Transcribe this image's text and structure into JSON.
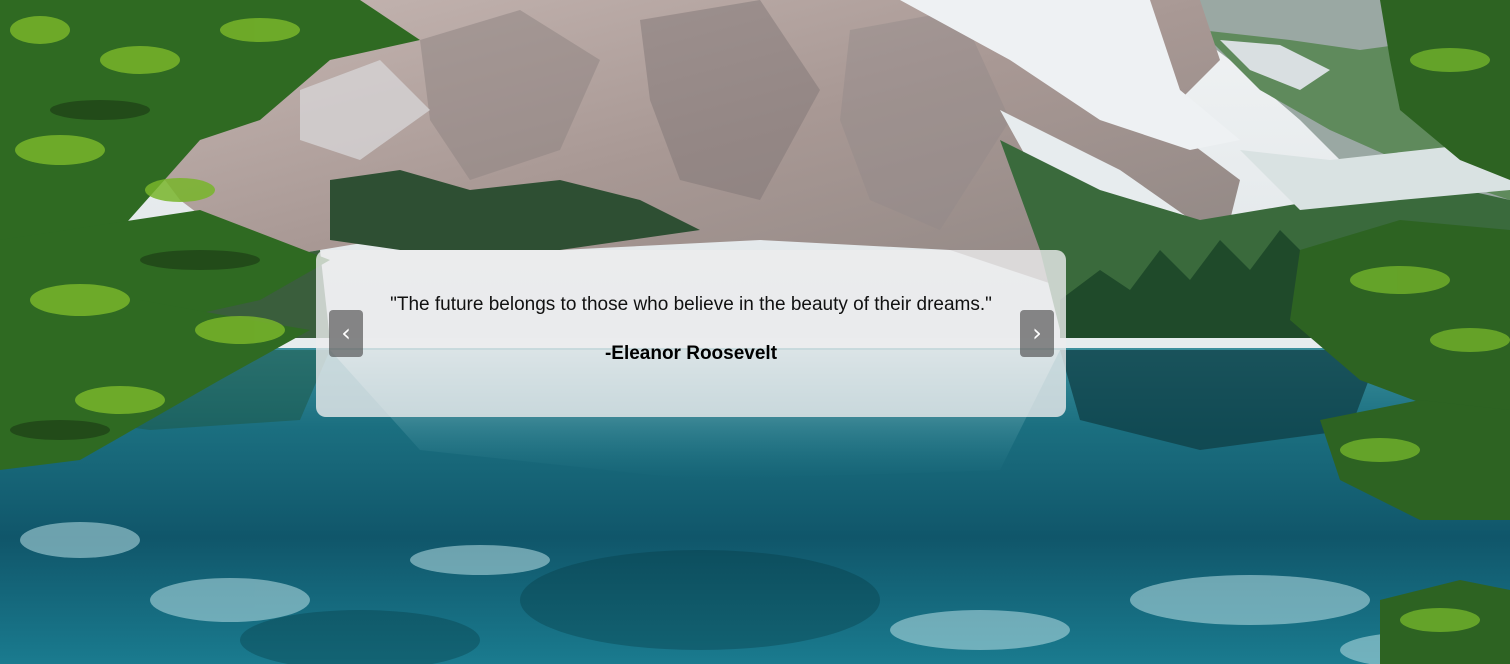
{
  "background": {
    "description_icon": "mountain-lake-landscape",
    "colors": {
      "sky": "#e9ecef",
      "rock": "#b7a9a6",
      "snow": "#eef1f3",
      "forest": "#2f5a2f",
      "pine": "#3c7a24",
      "lake": "#17707f",
      "lake_dark": "#0c4450"
    }
  },
  "quote": {
    "text": "\"The future belongs to those who believe in the beauty of their dreams.\"",
    "author": "-Eleanor Roosevelt"
  },
  "nav": {
    "prev_label": "‹",
    "next_label": "›",
    "prev_icon": "chevron-left-icon",
    "next_icon": "chevron-right-icon"
  }
}
